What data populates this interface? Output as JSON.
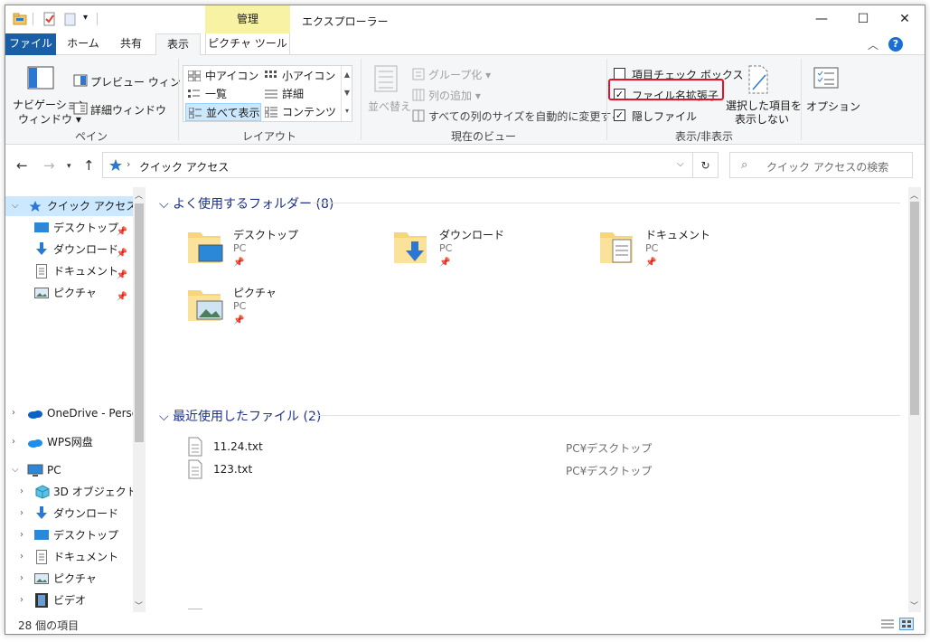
{
  "titlebar": {
    "title": "エクスプローラー",
    "context_tab": "管理",
    "minimize": "—",
    "maximize": "☐",
    "close": "✕"
  },
  "tabs": {
    "file": "ファイル",
    "home": "ホーム",
    "share": "共有",
    "view": "表示",
    "picture_tools": "ピクチャ ツール",
    "expand": "︿",
    "help": "?"
  },
  "ribbon": {
    "pane": {
      "nav_pane_line1": "ナビゲーション",
      "nav_pane_line2": "ウィンドウ ▾",
      "preview_pane": "プレビュー ウィンドウ",
      "details_pane": "詳細ウィンドウ",
      "label": "ペイン"
    },
    "layout": {
      "medium_icons": "中アイコン",
      "small_icons": "小アイコン",
      "list": "一覧",
      "details": "詳細",
      "tiles": "並べて表示",
      "content": "コンテンツ",
      "label": "レイアウト"
    },
    "current_view": {
      "sort_by": "並べ替え",
      "group_by": "グループ化 ▾",
      "add_columns": "列の追加 ▾",
      "size_all_columns": "すべての列のサイズを自動的に変更する",
      "label": "現在のビュー"
    },
    "show_hide": {
      "item_check_boxes": "項目チェック ボックス",
      "file_name_extensions": "ファイル名拡張子",
      "hidden_items": "隠しファイル",
      "item_check_boxes_checked": false,
      "file_name_extensions_checked": true,
      "hidden_items_checked": true,
      "hide_selected_line1": "選択した項目を",
      "hide_selected_line2": "表示しない",
      "label": "表示/非表示"
    },
    "options": "オプション"
  },
  "address": {
    "path": "クイック アクセス",
    "search_placeholder": "クイック アクセスの検索"
  },
  "navpane": {
    "items": [
      {
        "label": "クイック アクセス",
        "selected": true,
        "pinned": false,
        "icon": "star-icon"
      },
      {
        "label": "デスクトップ",
        "pinned": true,
        "icon": "desktop-icon"
      },
      {
        "label": "ダウンロード",
        "pinned": true,
        "icon": "download-icon"
      },
      {
        "label": "ドキュメント",
        "pinned": true,
        "icon": "document-icon"
      },
      {
        "label": "ピクチャ",
        "pinned": true,
        "icon": "picture-icon"
      },
      {
        "label": "OneDrive - Persor",
        "icon": "cloud-icon"
      },
      {
        "label": "WPS网盘",
        "icon": "cloud-icon"
      },
      {
        "label": "PC",
        "icon": "pc-icon"
      },
      {
        "label": "3D オブジェクト",
        "icon": "cube-icon"
      },
      {
        "label": "ダウンロード",
        "icon": "download-icon"
      },
      {
        "label": "デスクトップ",
        "icon": "desktop-icon"
      },
      {
        "label": "ドキュメント",
        "icon": "document-icon"
      },
      {
        "label": "ピクチャ",
        "icon": "picture-icon"
      },
      {
        "label": "ビデオ",
        "icon": "video-icon"
      }
    ]
  },
  "content": {
    "frequent_header": "よく使用するフォルダー (8)",
    "recent_header": "最近使用したファイル (2)",
    "folders": [
      {
        "name": "デスクトップ",
        "location": "PC"
      },
      {
        "name": "ダウンロード",
        "location": "PC"
      },
      {
        "name": "ドキュメント",
        "location": "PC"
      },
      {
        "name": "ピクチャ",
        "location": "PC"
      }
    ],
    "files": [
      {
        "name": "11.24.txt",
        "location": "PC¥デスクトップ"
      },
      {
        "name": "123.txt",
        "location": "PC¥デスクトップ"
      }
    ]
  },
  "status": {
    "item_count": "28 個の項目"
  }
}
